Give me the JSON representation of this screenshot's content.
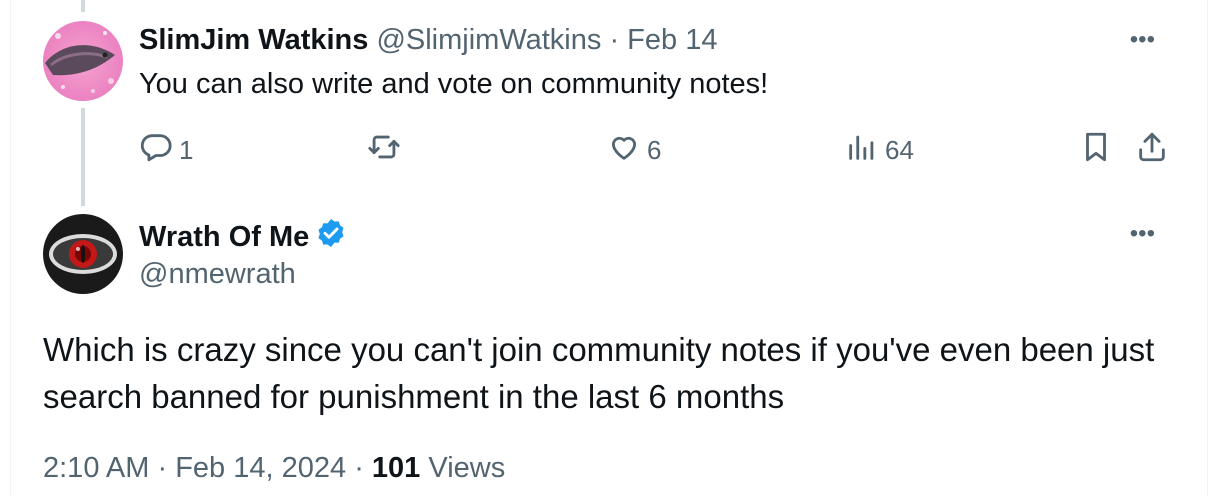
{
  "reply": {
    "display_name": "SlimJim Watkins",
    "handle": "@SlimjimWatkins",
    "separator": "·",
    "date": "Feb 14",
    "text": "You can also write and vote on community notes!",
    "more_icon": "more-horizontal-icon",
    "actions": {
      "reply_count": "1",
      "like_count": "6",
      "views_count": "64"
    }
  },
  "main": {
    "display_name": "Wrath Of Me",
    "verified": true,
    "handle": "@nmewrath",
    "text": "Which is crazy since you can't join community notes if you've even been just search banned for punishment in the last 6 months",
    "time": "2:10 AM",
    "separator": "·",
    "date": "Feb 14, 2024",
    "separator2": "·",
    "views_count": "101",
    "views_label": "Views"
  },
  "colors": {
    "muted": "#536471",
    "text": "#0f1419",
    "verified": "#1d9bf0",
    "thread_line": "#cfd9de"
  }
}
